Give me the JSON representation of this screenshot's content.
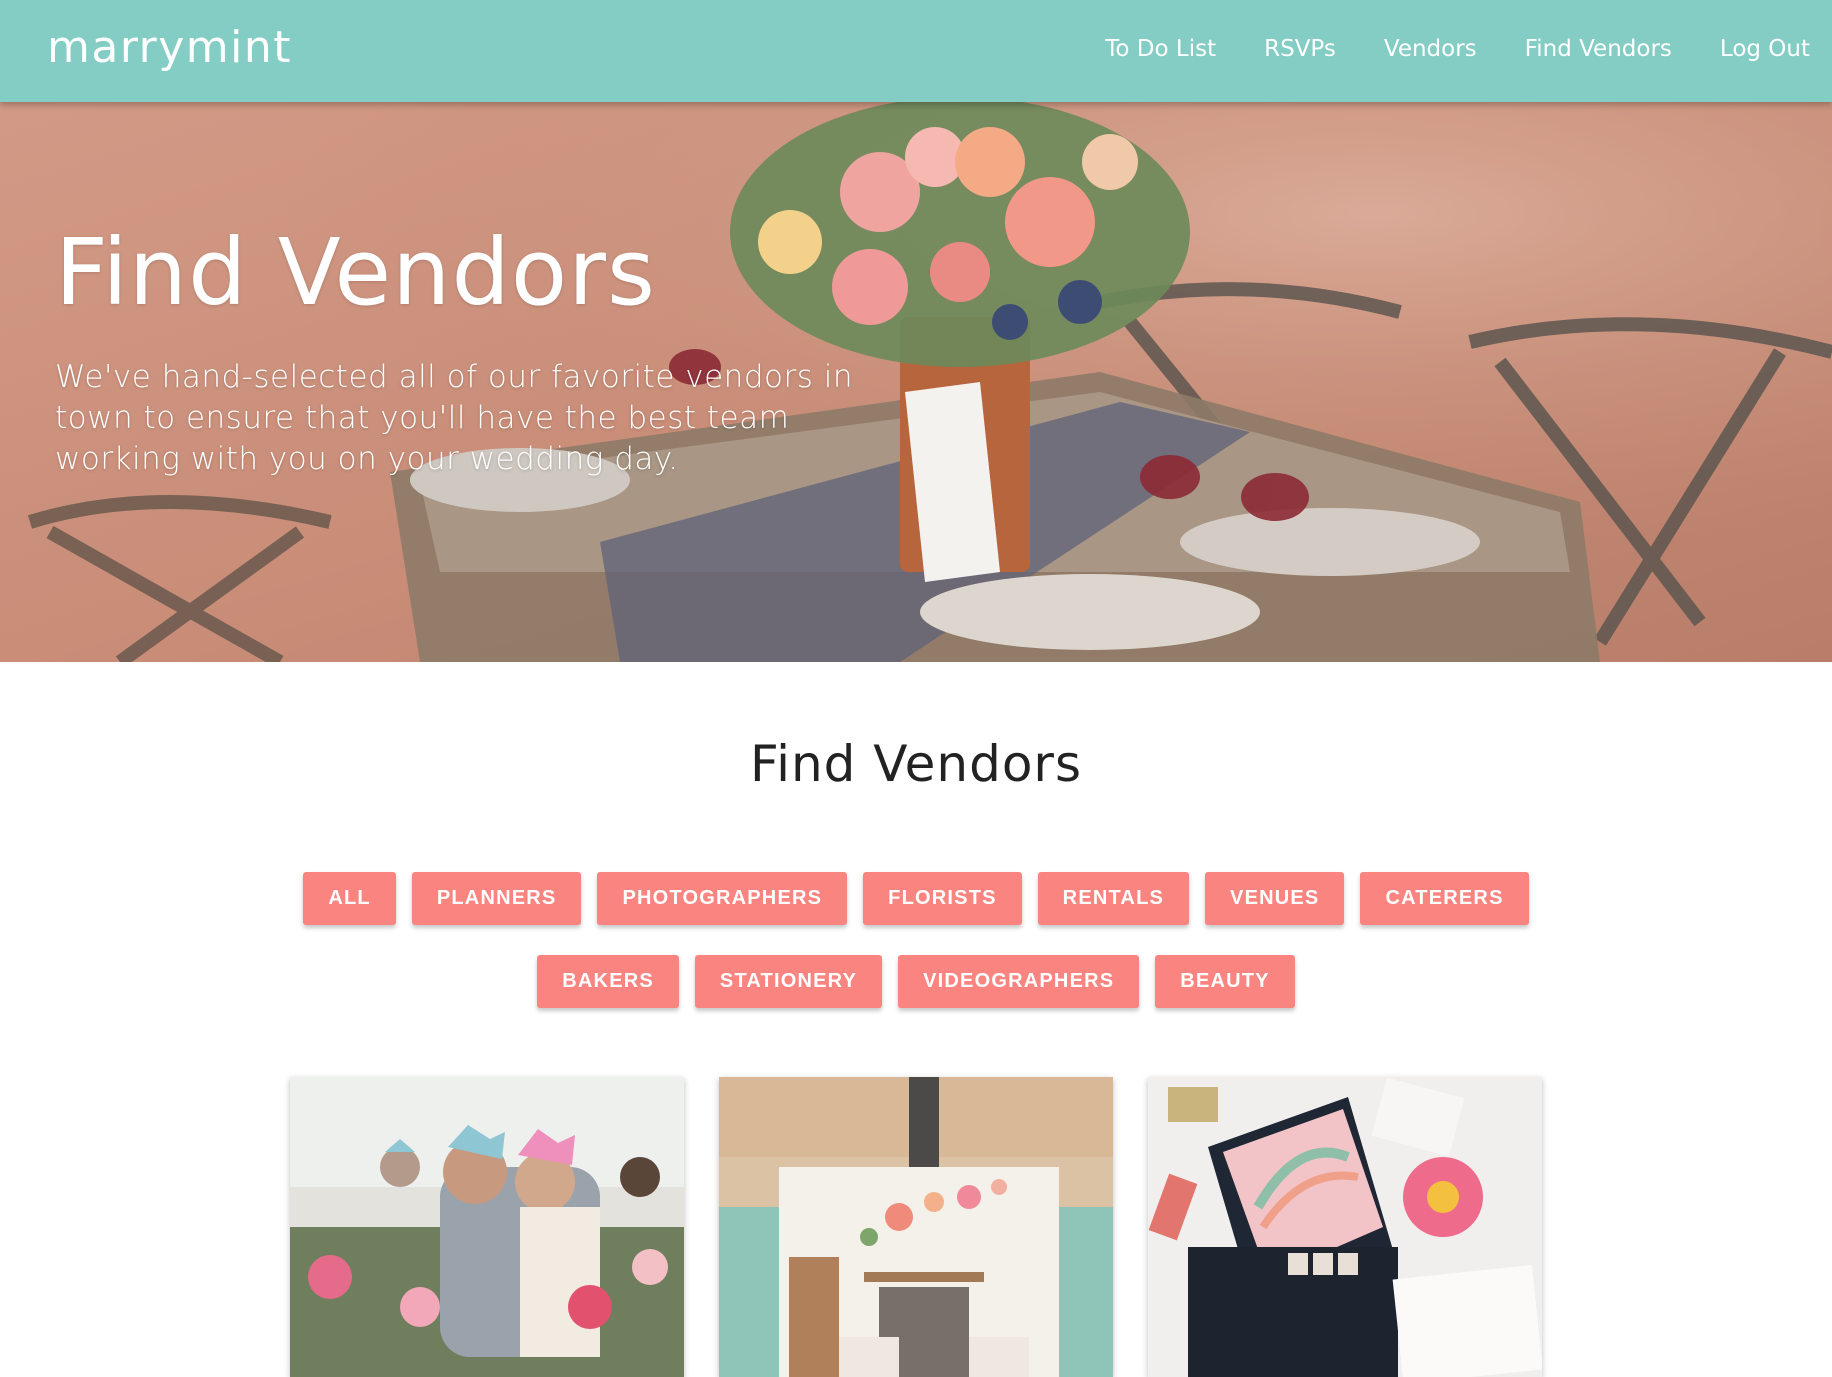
{
  "nav": {
    "brand": "marrymint",
    "links": [
      "To Do List",
      "RSVPs",
      "Vendors",
      "Find Vendors",
      "Log Out"
    ]
  },
  "hero": {
    "title": "Find Vendors",
    "description": "We've hand-selected all of our favorite vendors in town to ensure that you'll have the best team working with you on your wedding day."
  },
  "section": {
    "title": "Find Vendors",
    "filters_row1": [
      "ALL",
      "PLANNERS",
      "PHOTOGRAPHERS",
      "FLORISTS",
      "RENTALS",
      "VENUES",
      "CATERERS"
    ],
    "filters_row2": [
      "BAKERS",
      "STATIONERY",
      "VIDEOGRAPHERS",
      "BEAUTY"
    ]
  },
  "colors": {
    "nav_bg": "#83cdc4",
    "accent": "#fa8580",
    "text_dark": "#222222"
  }
}
